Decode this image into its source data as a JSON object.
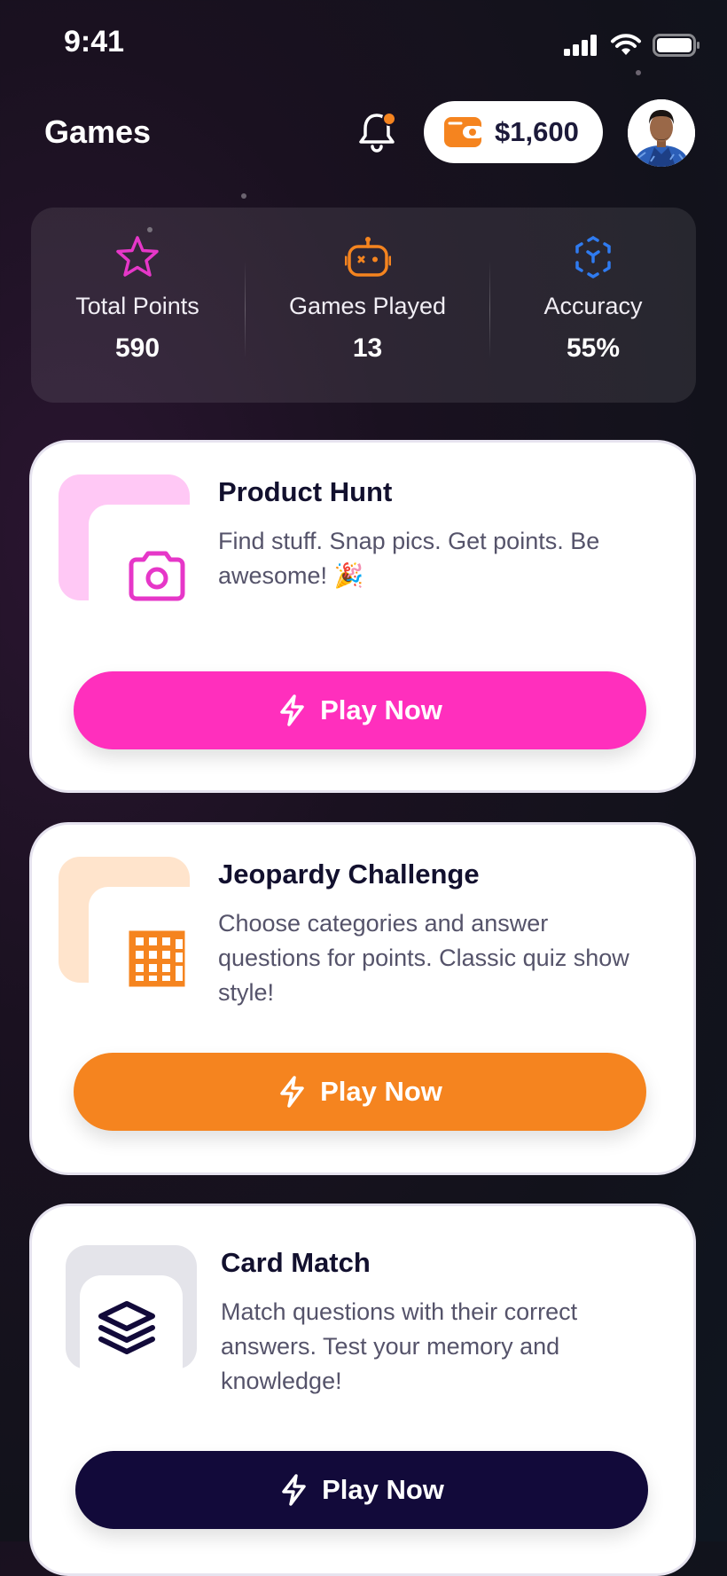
{
  "status_bar": {
    "time": "9:41"
  },
  "header": {
    "title": "Games",
    "wallet_amount": "$1,600",
    "icons": [
      "bell-icon",
      "wallet-icon",
      "avatar"
    ]
  },
  "stats": [
    {
      "label": "Total Points",
      "value": "590",
      "icon": "star-icon",
      "color": "#e637c8"
    },
    {
      "label": "Games Played",
      "value": "13",
      "icon": "robot-icon",
      "color": "#f5841f"
    },
    {
      "label": "Accuracy",
      "value": "55%",
      "icon": "target-cube-icon",
      "color": "#2f7bf0"
    }
  ],
  "games": [
    {
      "title": "Product Hunt",
      "description": "Find stuff. Snap pics. Get points. Be awesome! 🎉",
      "button_label": "Play Now",
      "icon": "camera-icon",
      "accent": "#ff2fbd",
      "thumb_color": "#ffc8f5"
    },
    {
      "title": "Jeopardy Challenge",
      "description": "Choose categories and answer questions for points. Classic quiz show style!",
      "button_label": "Play Now",
      "icon": "grid-board-icon",
      "accent": "#f5841f",
      "thumb_color": "#ffe4cc"
    },
    {
      "title": "Card Match",
      "description": "Match questions with their correct answers. Test your memory and knowledge!",
      "button_label": "Play Now",
      "icon": "card-stack-icon",
      "accent": "#120a3a",
      "thumb_color": "#e4e4ea"
    }
  ]
}
